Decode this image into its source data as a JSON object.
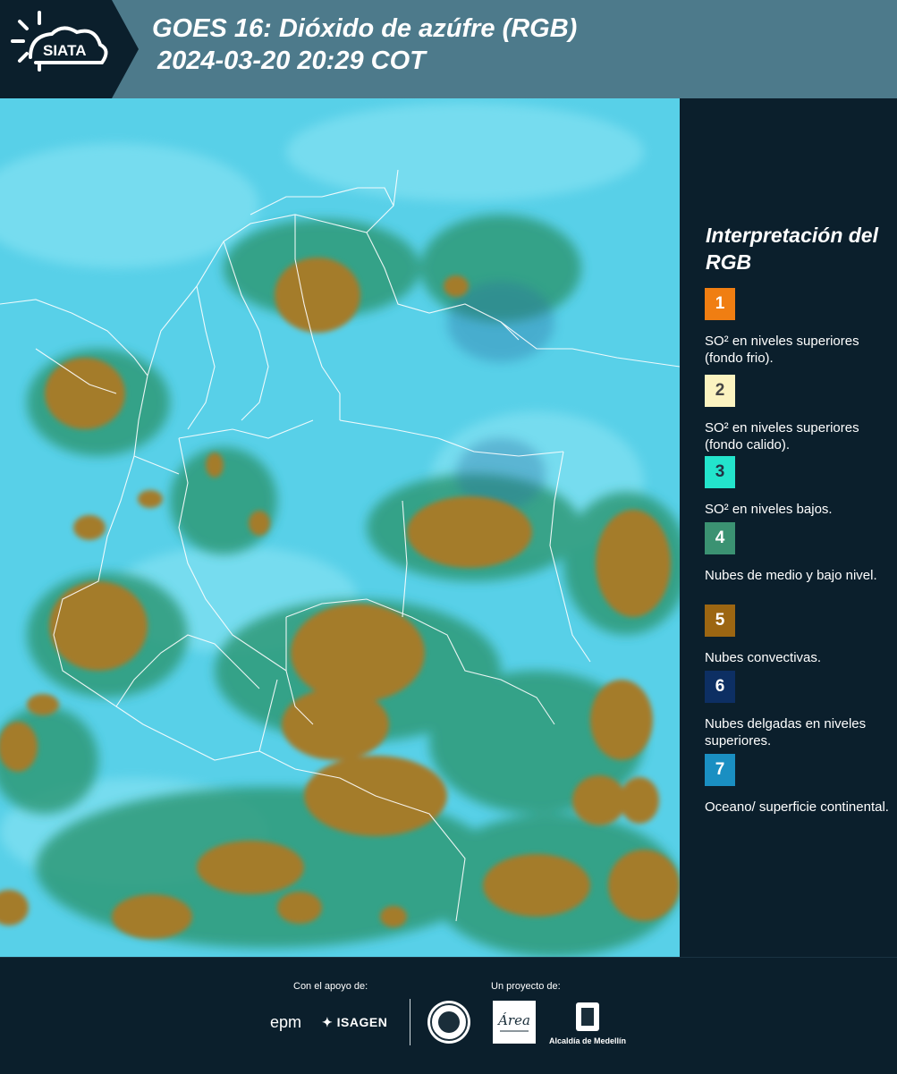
{
  "header": {
    "logo_text": "SIATA",
    "title_line1": "GOES 16: Dióxido de azúfre (RGB)",
    "title_line2": "2024-03-20 20:29 COT"
  },
  "map": {
    "icon": "satellite-rgb-map",
    "background_color": "#55cfe7",
    "cloud_color": "#a07a28",
    "vegetation_color": "#2f9a78",
    "border_color": "#ffffff"
  },
  "legend": {
    "title": "Interpretación del RGB",
    "items": [
      {
        "number": "1",
        "color": "#f07e12",
        "text": "SO² en niveles superiores (fondo frio)."
      },
      {
        "number": "2",
        "color": "#fbf3c0",
        "text": "SO² en niveles superiores (fondo calido)."
      },
      {
        "number": "3",
        "color": "#23e4cc",
        "text": "SO² en niveles bajos."
      },
      {
        "number": "4",
        "color": "#3b9272",
        "text": "Nubes de medio y bajo nivel."
      },
      {
        "number": "5",
        "color": "#9c6612",
        "text": "Nubes convectivas."
      },
      {
        "number": "6",
        "color": "#0d2f63",
        "text": "Nubes delgadas en niveles superiores."
      },
      {
        "number": "7",
        "color": "#1a8fc2",
        "text": "Oceano/ superficie continental."
      }
    ]
  },
  "footer": {
    "support_label": "Con el apoyo de:",
    "project_label": "Un proyecto de:",
    "epm": "epm",
    "isagen": "ISAGEN",
    "area_logo_text": "Área",
    "alcaldia": "Alcaldía de Medellín"
  }
}
